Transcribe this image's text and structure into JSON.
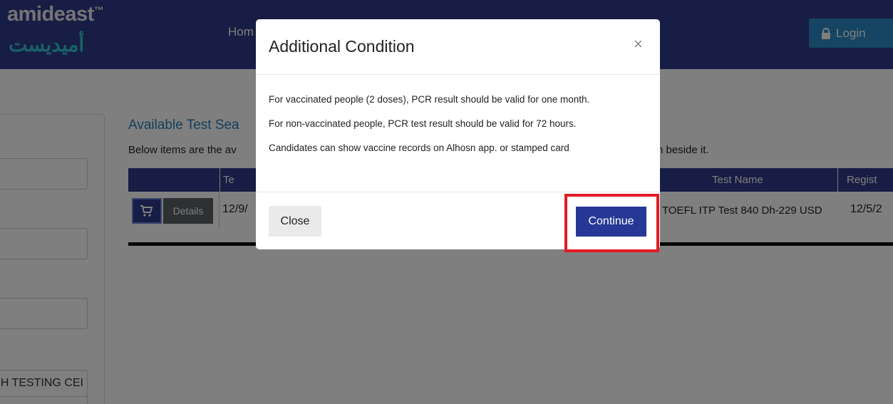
{
  "header": {
    "logo_en": "amideast",
    "logo_tm": "™",
    "logo_ar": "أميديست",
    "nav_home": "Hom",
    "login_label": "Login"
  },
  "page": {
    "section_title": "Available Test Sea",
    "section_desc": "Below items are the av",
    "section_desc_end": "n beside it.",
    "side_select_text": "H TESTING CEI",
    "table": {
      "headers": [
        "Te",
        "Test Name",
        "Regist"
      ],
      "row": {
        "details_label": "Details",
        "date": "12/9/",
        "test_name": "TOEFL ITP Test 840 Dh-229 USD",
        "reg_date": "12/5/2"
      }
    }
  },
  "modal": {
    "title": "Additional Condition",
    "close_icon": "×",
    "lines": [
      "For vaccinated people (2 doses), PCR result should be valid for one month.",
      "For non-vaccinated people, PCR test result should be valid for 72 hours.",
      "Candidates can show vaccine records on Alhosn app. or stamped card"
    ],
    "close_label": "Close",
    "continue_label": "Continue"
  },
  "colors": {
    "header_bg": "#2e3a88",
    "login_bg": "#2a8bc6",
    "continue_bg": "#263796",
    "highlight": "#e21a24"
  }
}
